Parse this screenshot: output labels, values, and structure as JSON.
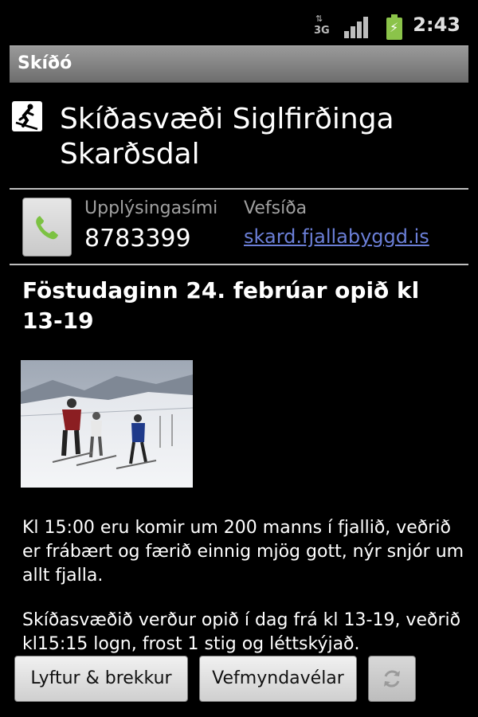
{
  "status_bar": {
    "network": "3G",
    "time": "2:43"
  },
  "app": {
    "title": "Skíðó"
  },
  "resort": {
    "name": "Skíðasvæði Siglfirðinga Skarðsdal"
  },
  "contact": {
    "phone_label": "Upplýsingasími",
    "phone_value": "8783399",
    "web_label": "Vefsíða",
    "web_value": "skard.fjallabyggd.is"
  },
  "article": {
    "heading": "Föstudaginn 24. febrúar opið kl 13-19",
    "paragraphs": [
      "Kl 15:00 eru komir um 200 manns í fjallið, veðrið er frábært og færið einnig mjög gott, nýr snjór um allt fjalla.",
      "Skíðasvæðið verður opið í dag frá kl 13-19, veðrið kl15:15 logn, frost 1 stig og léttskýjað."
    ]
  },
  "buttons": {
    "lifts": "Lyftur & brekkur",
    "webcams": "Vefmyndavélar",
    "refresh_icon": "refresh-icon"
  },
  "colors": {
    "link": "#6b7fd7",
    "phone_icon": "#7cc242",
    "battery": "#8bc34a"
  }
}
